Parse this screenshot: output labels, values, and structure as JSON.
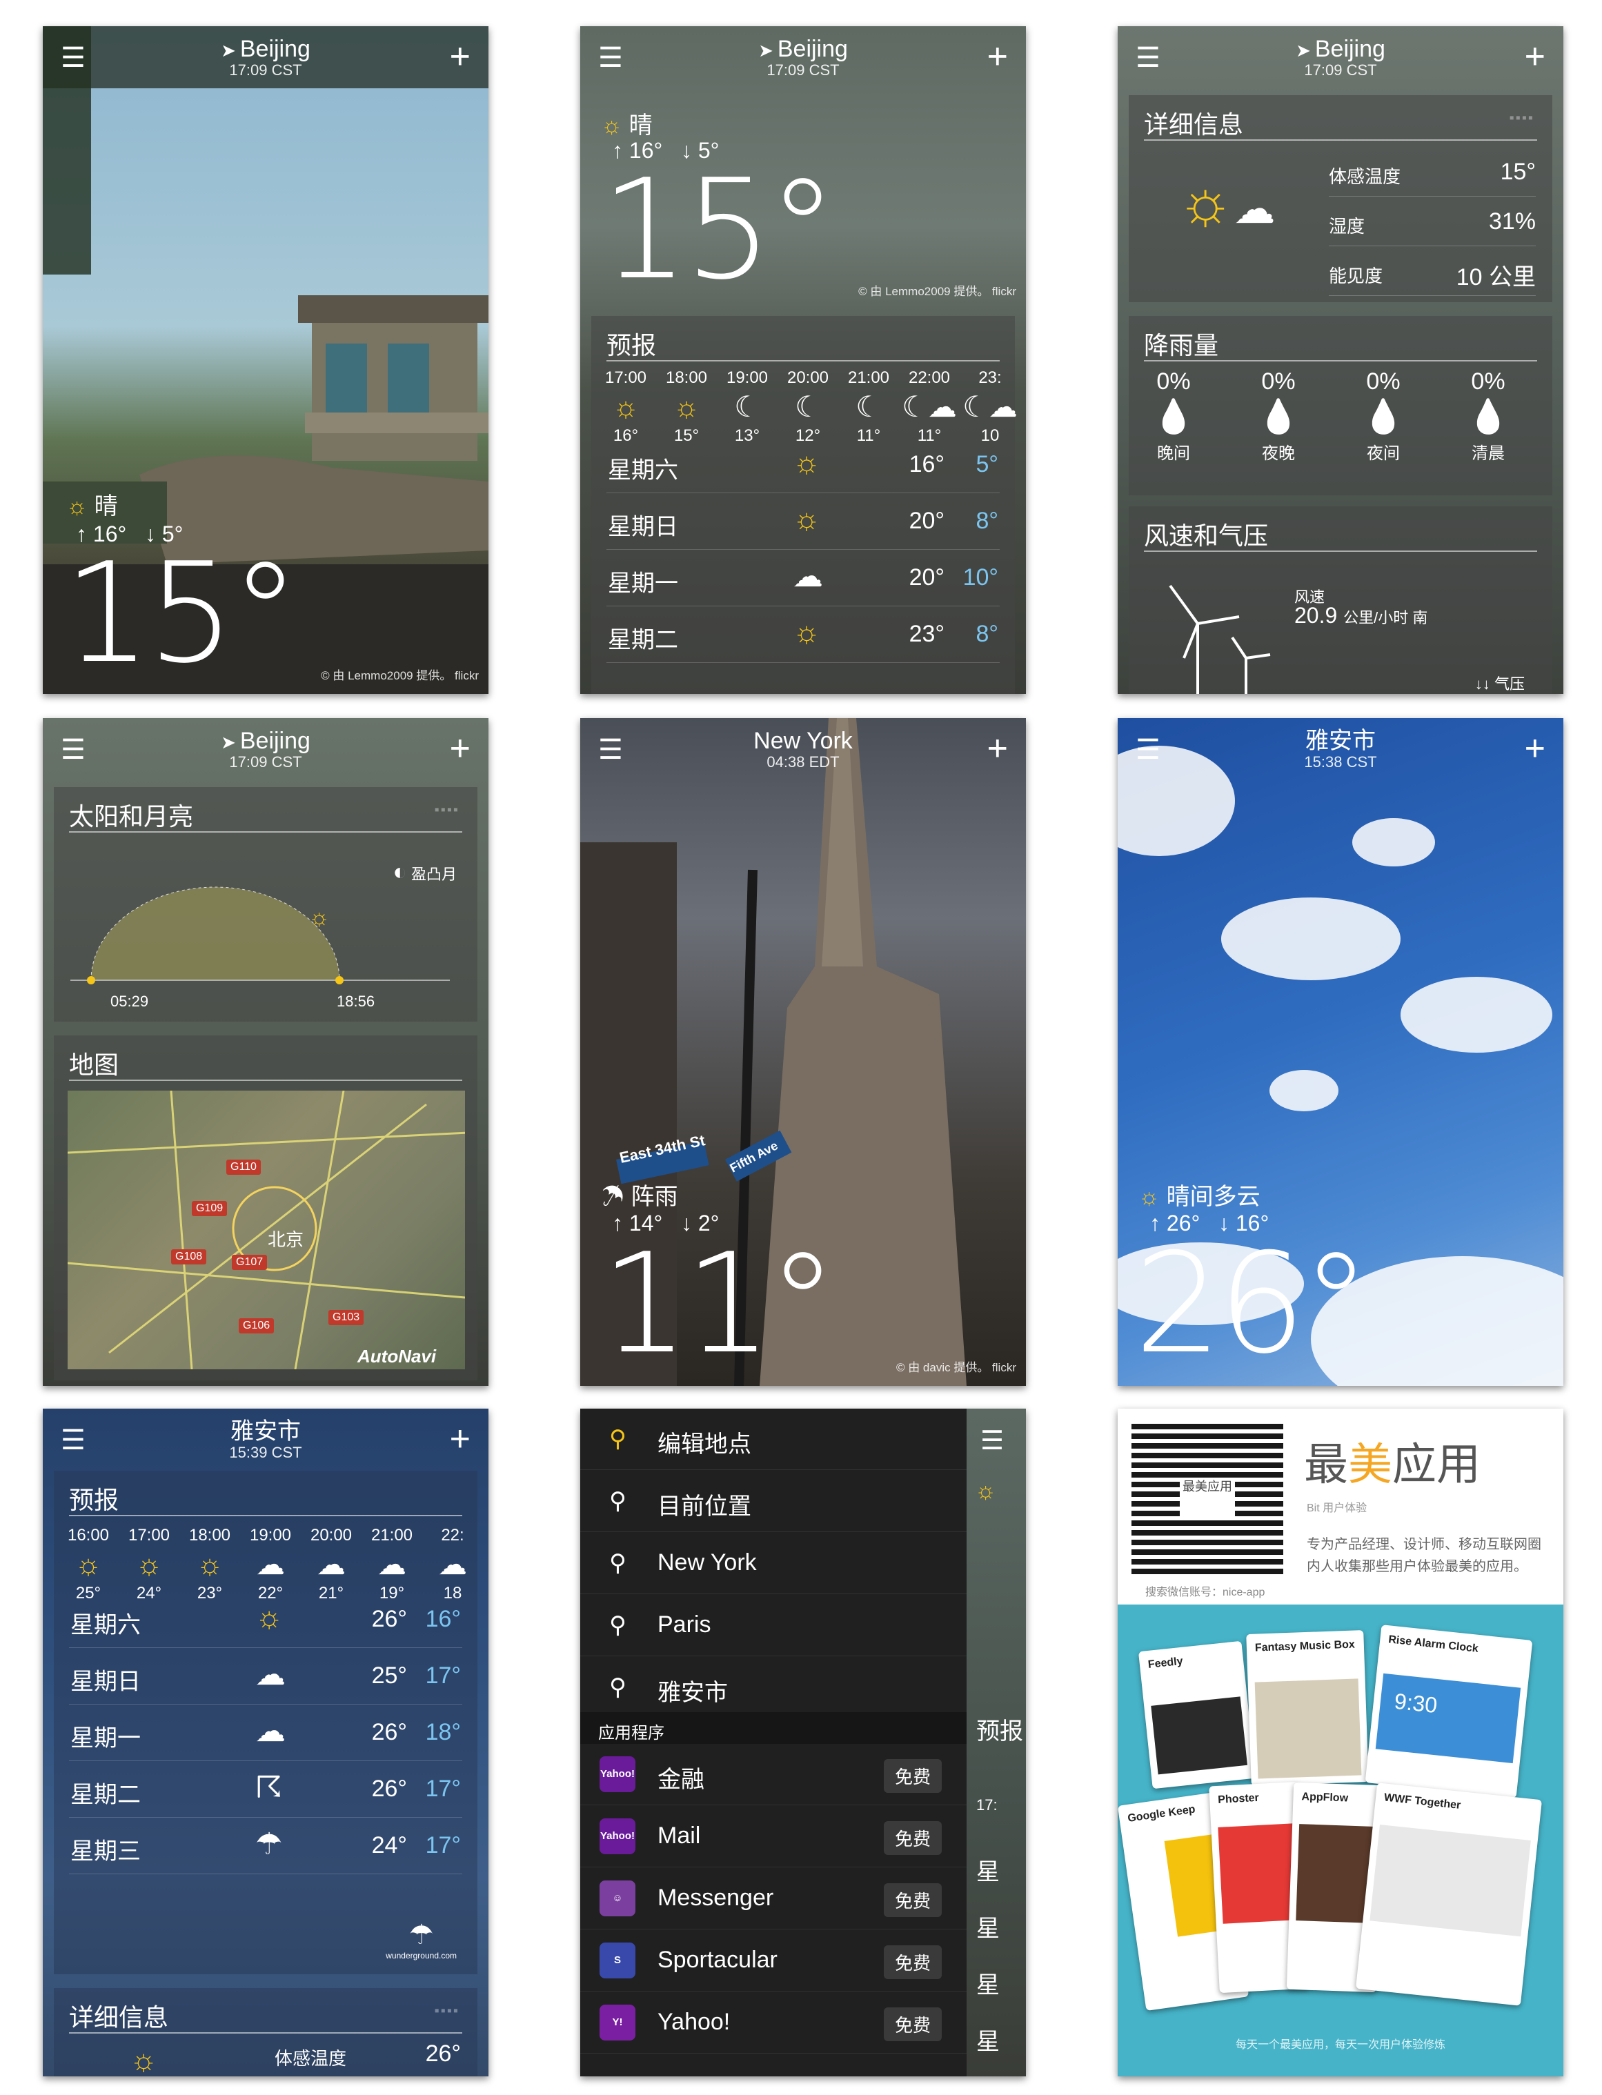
{
  "s1": {
    "city": "Beijing",
    "time": "17:09 CST",
    "condition": "晴",
    "hi": "16°",
    "lo": "5°",
    "temp": "15°",
    "credit": "© 由 Lemmo2009 提供。 flickr"
  },
  "s2": {
    "city": "Beijing",
    "time": "17:09 CST",
    "condition": "晴",
    "hi": "16°",
    "lo": "5°",
    "temp": "15°",
    "credit": "© 由 Lemmo2009 提供。 flickr",
    "forecast_title": "预报",
    "hourly": [
      {
        "t": "17:00",
        "v": "16°",
        "icon": "sun"
      },
      {
        "t": "18:00",
        "v": "15°",
        "icon": "sun"
      },
      {
        "t": "19:00",
        "v": "13°",
        "icon": "moon"
      },
      {
        "t": "20:00",
        "v": "12°",
        "icon": "moon"
      },
      {
        "t": "21:00",
        "v": "11°",
        "icon": "moon"
      },
      {
        "t": "22:00",
        "v": "11°",
        "icon": "moon-cloud"
      },
      {
        "t": "23:",
        "v": "10",
        "icon": "moon-cloud"
      }
    ],
    "daily": [
      {
        "d": "星期六",
        "h": "16°",
        "l": "5°"
      },
      {
        "d": "星期日",
        "h": "20°",
        "l": "8°"
      },
      {
        "d": "星期一",
        "h": "20°",
        "l": "10°"
      },
      {
        "d": "星期二",
        "h": "23°",
        "l": "8°"
      }
    ]
  },
  "s3": {
    "city": "Beijing",
    "time": "17:09 CST",
    "detail_title": "详细信息",
    "details": [
      {
        "k": "体感温度",
        "v": "15°"
      },
      {
        "k": "湿度",
        "v": "31%"
      },
      {
        "k": "能见度",
        "v": "10 公里"
      }
    ],
    "rain_title": "降雨量",
    "rain": [
      {
        "p": "0%",
        "l": "晚间"
      },
      {
        "p": "0%",
        "l": "夜晚"
      },
      {
        "p": "0%",
        "l": "夜间"
      },
      {
        "p": "0%",
        "l": "清晨"
      }
    ],
    "wind_title": "风速和气压",
    "wind_label": "风速",
    "wind_value": "20.9",
    "wind_unit": "公里/小时 南",
    "pressure_label": "气压"
  },
  "s4": {
    "city": "Beijing",
    "time": "17:09 CST",
    "sun_title": "太阳和月亮",
    "moon_phase": "盈凸月",
    "sunrise": "05:29",
    "sunset": "18:56",
    "map_title": "地图",
    "map_labels": [
      "北京",
      "G110",
      "G109",
      "G108",
      "G107",
      "G106",
      "G103",
      "AutoNavi"
    ]
  },
  "s5": {
    "city": "New York",
    "time": "04:38 EDT",
    "condition": "阵雨",
    "hi": "14°",
    "lo": "2°",
    "temp": "11°",
    "credit": "© 由 davic 提供。 flickr",
    "street1": "East 34th St",
    "street2": "Fifth Ave"
  },
  "s6": {
    "city": "雅安市",
    "time": "15:38 CST",
    "condition": "晴间多云",
    "hi": "26°",
    "lo": "16°",
    "temp": "26°"
  },
  "s7": {
    "city": "雅安市",
    "time": "15:39 CST",
    "forecast_title": "预报",
    "hourly": [
      {
        "t": "16:00",
        "v": "25°"
      },
      {
        "t": "17:00",
        "v": "24°"
      },
      {
        "t": "18:00",
        "v": "23°"
      },
      {
        "t": "19:00",
        "v": "22°"
      },
      {
        "t": "20:00",
        "v": "21°"
      },
      {
        "t": "21:00",
        "v": "19°"
      },
      {
        "t": "22:",
        "v": "18"
      }
    ],
    "daily": [
      {
        "d": "星期六",
        "h": "26°",
        "l": "16°"
      },
      {
        "d": "星期日",
        "h": "25°",
        "l": "17°"
      },
      {
        "d": "星期一",
        "h": "26°",
        "l": "18°"
      },
      {
        "d": "星期二",
        "h": "26°",
        "l": "17°"
      },
      {
        "d": "星期三",
        "h": "24°",
        "l": "17°"
      }
    ],
    "detail_title": "详细信息",
    "feels_label": "体感温度",
    "feels_value": "26°",
    "brand": "wunderground.com"
  },
  "s8": {
    "locations": [
      "编辑地点",
      "目前位置",
      "New York",
      "Paris",
      "雅安市"
    ],
    "apps_header": "应用程序",
    "apps": [
      {
        "n": "金融",
        "b": "Yahoo!",
        "c": "#6a1b9a"
      },
      {
        "n": "Mail",
        "b": "Yahoo!",
        "c": "#6a1b9a"
      },
      {
        "n": "Messenger",
        "b": "☺",
        "c": "#7b3fa0"
      },
      {
        "n": "Sportacular",
        "b": "S",
        "c": "#3949ab"
      },
      {
        "n": "Yahoo!",
        "b": "Y!",
        "c": "#7b1fa2"
      }
    ],
    "free_label": "免费",
    "peek": [
      "预报",
      "17:",
      "星",
      "星",
      "星",
      "星"
    ]
  },
  "s9": {
    "title_a": "最",
    "title_b": "美",
    "title_c": "应用",
    "subtitle": "Bit 用户体验",
    "desc1": "专为产品经理、设计师、移动互联网圈",
    "desc2": "内人收集那些用户体验最美的应用。",
    "wechat": "搜索微信账号：nice-app",
    "qr_text": "最美应用",
    "cards": [
      "Feedly",
      "Fantasy Music Box",
      "Rise Alarm Clock",
      "Google Keep",
      "Phoster",
      "AppFlow",
      "WWF Together"
    ],
    "alarm_time": "9:30",
    "footer": "每天一个最美应用，每天一次用户体验修炼"
  }
}
